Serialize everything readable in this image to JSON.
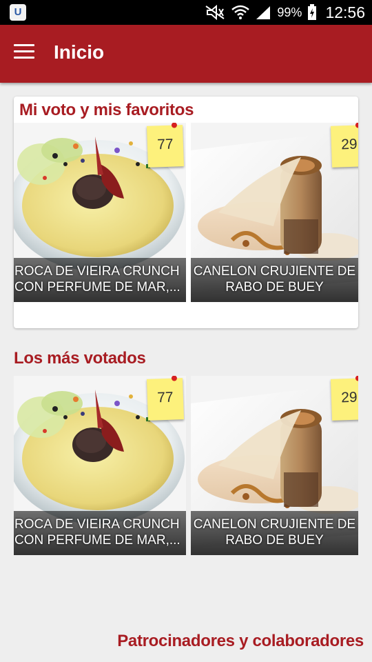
{
  "status_bar": {
    "app_icon": "app-u-icon",
    "battery": "99%",
    "time": "12:56"
  },
  "toolbar": {
    "title": "Inicio",
    "menu_icon": "hamburger-menu-icon"
  },
  "favorites": {
    "title": "Mi voto y mis favoritos",
    "items": [
      {
        "caption": "ROCA DE VIEIRA CRUNCH\nCON PERFUME DE MAR,...",
        "votes": "77"
      },
      {
        "caption": "CANELON CRUJIENTE DE\nRABO DE BUEY",
        "votes": "29"
      }
    ]
  },
  "top_voted": {
    "title": "Los más votados",
    "items": [
      {
        "caption": "ROCA DE VIEIRA CRUNCH\nCON PERFUME DE MAR,...",
        "votes": "77"
      },
      {
        "caption": "CANELON CRUJIENTE DE\nRABO DE BUEY",
        "votes": "29"
      }
    ]
  },
  "sponsors": {
    "title": "Patrocinadores y colaboradores"
  },
  "colors": {
    "primary": "#a81c22",
    "background": "#eeeeee",
    "note": "#fdf17c"
  }
}
